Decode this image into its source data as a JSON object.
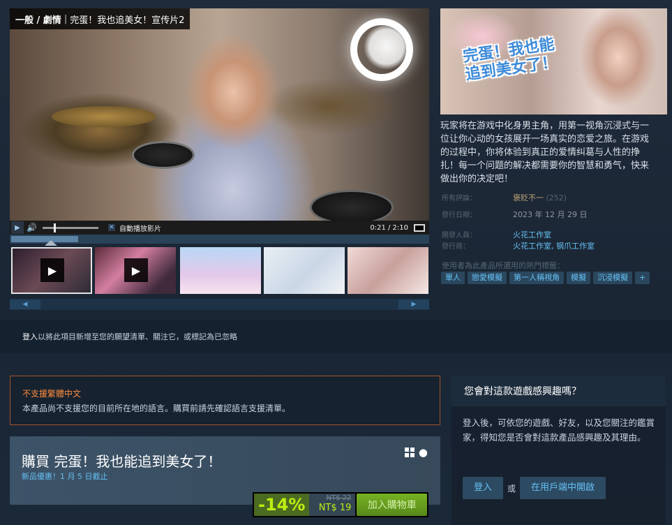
{
  "video": {
    "category": "一般 / 劇情",
    "separator": "|",
    "title": "完蛋！我也追美女！宣传片2",
    "autoplay_label": "自動播放影片",
    "autoplay_checked": true,
    "time": "0:21 / 2:10",
    "progress": 0.16
  },
  "capsule": {
    "logo_text": "完蛋！我也能追到美女了！"
  },
  "description": "玩家将在游戏中化身男主角，用第一视角沉浸式与一位让你心动的女孩展开一场真实的恋爱之旅。在游戏的过程中，你将体验到真正的爱情纠葛与人性的挣扎！每一个问题的解决都需要你的智慧和勇气，快来做出你的决定吧！",
  "info": {
    "reviews_label": "所有評論：",
    "reviews_value": "褒貶不一",
    "reviews_count": "(252)",
    "release_label": "發行日期：",
    "release_value": "2023 年 12 月 29 日",
    "developer_label": "開發人員：",
    "developer_value": "火花工作室",
    "publisher_label": "發行商：",
    "publisher_value": "火花工作室, 钢爪工作室",
    "tags_label": "使用者為此產品所選用的熱門標籤：",
    "tags": [
      "單人",
      "戀愛模擬",
      "第一人稱視角",
      "模擬",
      "沉浸模擬",
      "+"
    ]
  },
  "login_bar": {
    "link": "登入",
    "text": "以將此項目新增至您的願望清單、關注它，或標記為已忽略"
  },
  "language_warning": {
    "title": "不支援繁體中文",
    "body": "本產品尚不支援您的目前所在地的語言。購買前請先確認語言支援清單。"
  },
  "purchase": {
    "title": "購買 完蛋！我也能追到美女了！",
    "promo": "新品優惠！1 月 5 日截止",
    "discount": "-14%",
    "original_price": "NT$ 22",
    "final_price": "NT$ 19",
    "cart_label": "加入購物車"
  },
  "interest": {
    "heading": "您會對這款遊戲感興趣嗎？",
    "body": "登入後，可依您的遊戲、好友，以及您關注的鑑賞家，得知您是否會對這款產品感興趣及其理由。",
    "login_label": "登入",
    "or_label": "或",
    "open_client_label": "在用戶端中開啟"
  },
  "colors": {
    "accent_link": "#66c0f4",
    "discount_bg": "#4c6b22",
    "discount_text": "#beee11",
    "warning": "#ff8c3c",
    "mixed_review": "#b9a074"
  },
  "icons": [
    "play-icon",
    "volume-icon",
    "fullscreen-icon",
    "windows-icon",
    "apple-icon",
    "scroll-left-icon",
    "scroll-right-icon"
  ]
}
